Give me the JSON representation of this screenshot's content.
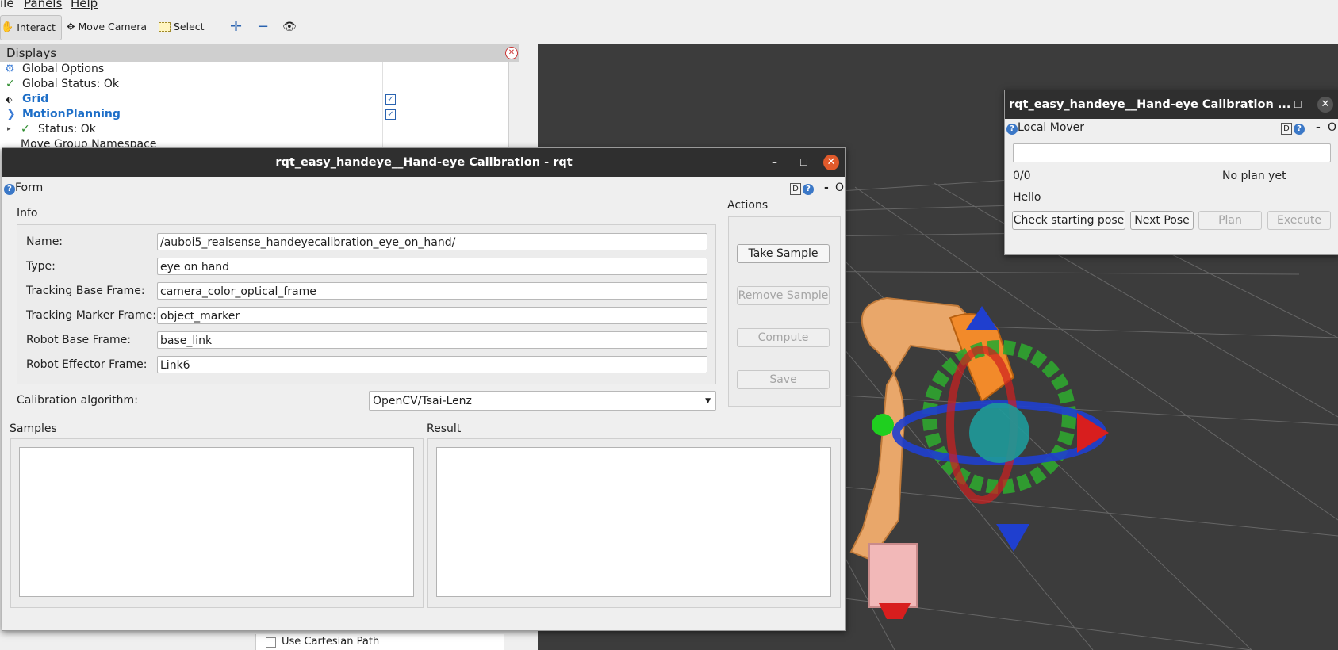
{
  "menubar": {
    "items": [
      "ile",
      "Panels",
      "Help"
    ]
  },
  "toolbar": {
    "interact": "Interact",
    "move_camera": "Move Camera",
    "select": "Select"
  },
  "displays": {
    "title": "Displays",
    "items": [
      {
        "label": "Global Options"
      },
      {
        "label": "Global Status: Ok"
      },
      {
        "label": "Grid",
        "checked": true
      },
      {
        "label": "MotionPlanning",
        "checked": true
      },
      {
        "label": "Status: Ok"
      },
      {
        "label": "Move Group Namespace"
      }
    ],
    "bottom_partial": "Use Cartesian Path"
  },
  "main_window": {
    "title": "rqt_easy_handeye__Hand-eye Calibration - rqt",
    "form_label": "Form",
    "d_label": "D",
    "dash": "-",
    "o_label": "O",
    "info": {
      "title": "Info",
      "fields": [
        {
          "label": "Name:",
          "value": "/auboi5_realsense_handeyecalibration_eye_on_hand/"
        },
        {
          "label": "Type:",
          "value": "eye on hand"
        },
        {
          "label": "Tracking Base Frame:",
          "value": "camera_color_optical_frame"
        },
        {
          "label": "Tracking Marker Frame:",
          "value": "object_marker"
        },
        {
          "label": "Robot Base Frame:",
          "value": "base_link"
        },
        {
          "label": "Robot Effector Frame:",
          "value": "Link6"
        }
      ]
    },
    "calibration_algorithm": {
      "label": "Calibration algorithm:",
      "value": "OpenCV/Tsai-Lenz"
    },
    "actions": {
      "title": "Actions",
      "take_sample": "Take Sample",
      "remove_sample": "Remove Sample",
      "compute": "Compute",
      "save": "Save"
    },
    "samples_title": "Samples",
    "result_title": "Result"
  },
  "local_mover": {
    "title": "rqt_easy_handeye__Hand-eye Calibration ...",
    "label": "Local Mover",
    "d_label": "D",
    "dash": "-",
    "o_label": "O",
    "input_value": "",
    "counter": "0/0",
    "plan_status": "No plan yet",
    "message": "Hello",
    "buttons": {
      "check_start": "Check starting pose",
      "next_pose": "Next Pose",
      "plan": "Plan",
      "execute": "Execute"
    }
  },
  "colors": {
    "viewport_bg": "#3c3c3c",
    "accent_blue": "#1e6fc8",
    "close_orange": "#e05a2b",
    "titlebar": "#2f2f2f"
  }
}
